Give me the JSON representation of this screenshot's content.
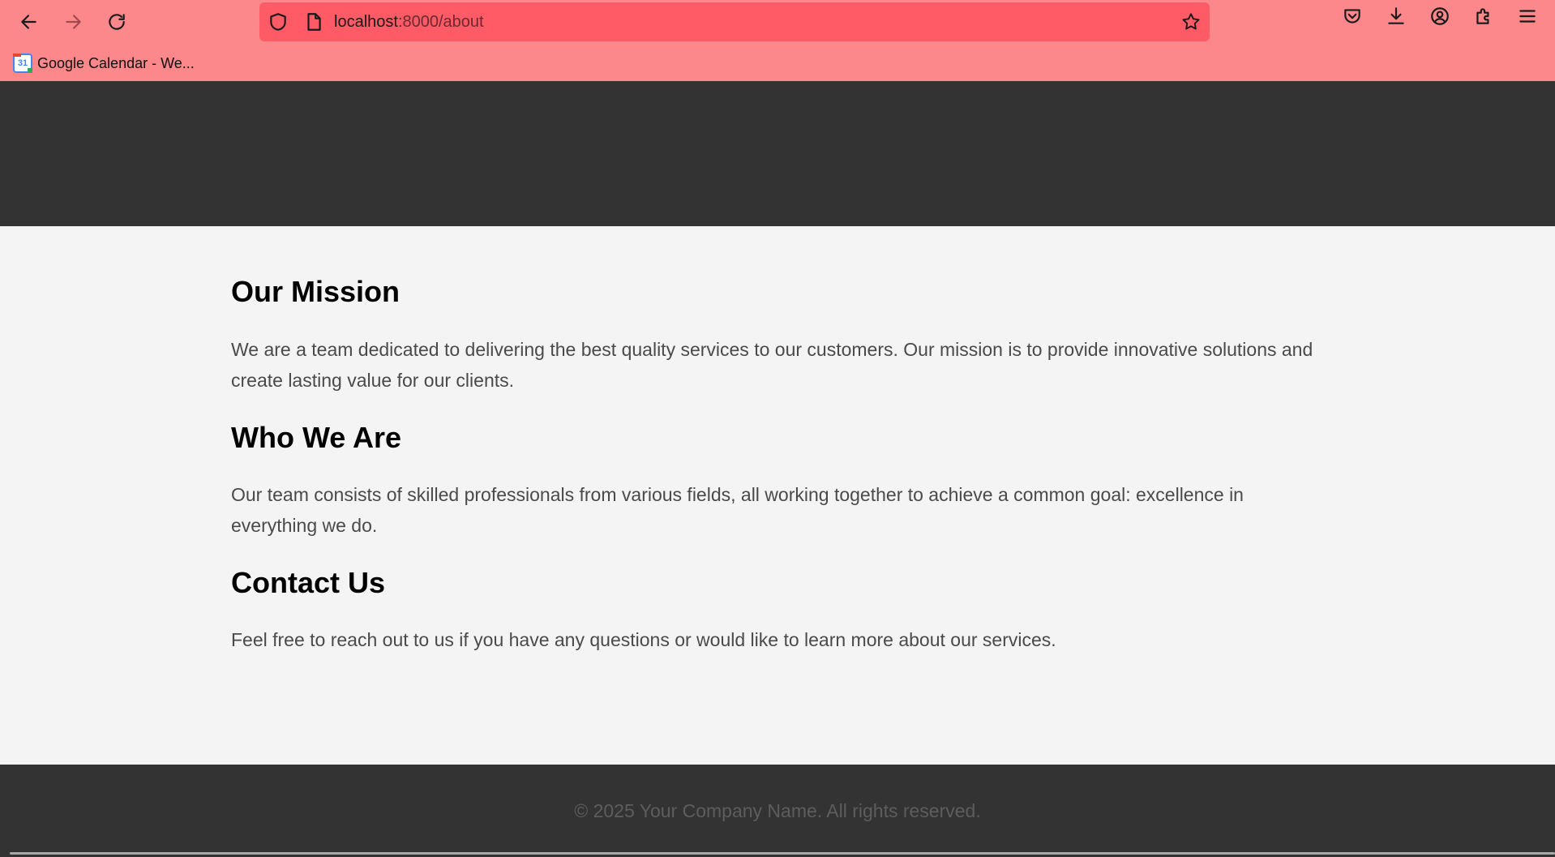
{
  "browser": {
    "url_host": "localhost",
    "url_path": ":8000/about",
    "bookmarks": [
      {
        "label": "Google Calendar - We...",
        "icon": "google-calendar-icon"
      }
    ],
    "icons": {
      "back": "arrow-left-icon",
      "forward": "arrow-right-icon",
      "reload": "reload-icon",
      "shield": "shield-icon",
      "page": "page-icon",
      "bookmark_star": "star-icon",
      "pocket": "pocket-icon",
      "downloads": "download-icon",
      "account": "account-icon",
      "extensions": "puzzle-icon",
      "menu": "hamburger-menu-icon"
    },
    "calendar_day": "31"
  },
  "page": {
    "sections": [
      {
        "title": "Our Mission",
        "text": "We are a team dedicated to delivering the best quality services to our customers. Our mission is to provide innovative solutions and create lasting value for our clients."
      },
      {
        "title": "Who We Are",
        "text": "Our team consists of skilled professionals from various fields, all working together to achieve a common goal: excellence in everything we do."
      },
      {
        "title": "Contact Us",
        "text": "Feel free to reach out to us if you have any questions or would like to learn more about our services."
      }
    ],
    "footer": "© 2025 Your Company Name. All rights reserved."
  },
  "colors": {
    "toolbar": "#fc888b",
    "urlbar": "#fe5b67",
    "header": "#333333",
    "body": "#f4f4f4"
  }
}
